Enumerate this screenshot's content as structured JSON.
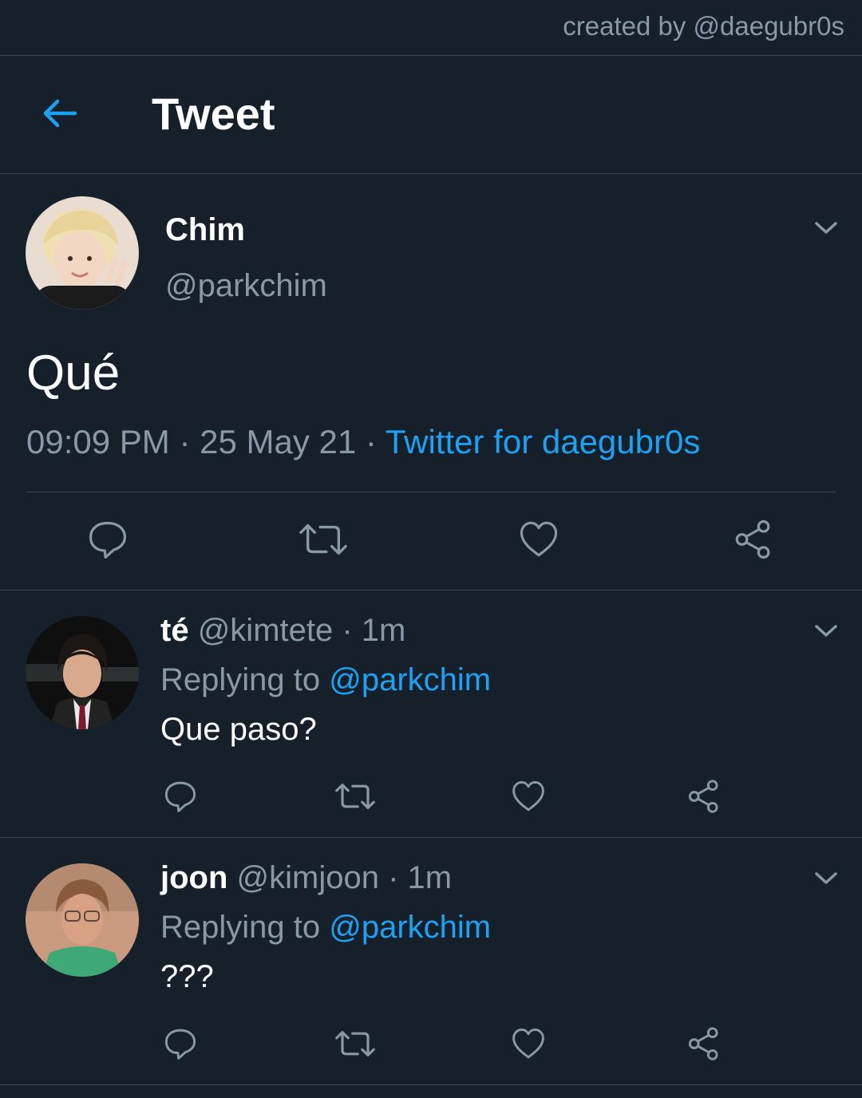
{
  "credit": "created by @daegubr0s",
  "header": {
    "title": "Tweet"
  },
  "tweet": {
    "name": "Chim",
    "handle": "@parkchim",
    "text": "Qué",
    "time": "09:09 PM",
    "sep": " · ",
    "date": "25 May 21",
    "client": "Twitter for daegubr0s"
  },
  "replies": [
    {
      "name": "té",
      "handle": "@kimtete",
      "time": "1m",
      "replying_prefix": "Replying to ",
      "replying_to": "@parkchim",
      "text": "Que paso?"
    },
    {
      "name": "joon",
      "handle": "@kimjoon",
      "time": "1m",
      "replying_prefix": "Replying to ",
      "replying_to": "@parkchim",
      "text": "???"
    }
  ],
  "colors": {
    "background": "#15202b",
    "accent": "#1da1f2",
    "muted": "#8899a6",
    "divider": "#38444d"
  },
  "icons": [
    "back-arrow-icon",
    "chevron-down-icon",
    "reply-icon",
    "retweet-icon",
    "like-icon",
    "share-icon"
  ]
}
